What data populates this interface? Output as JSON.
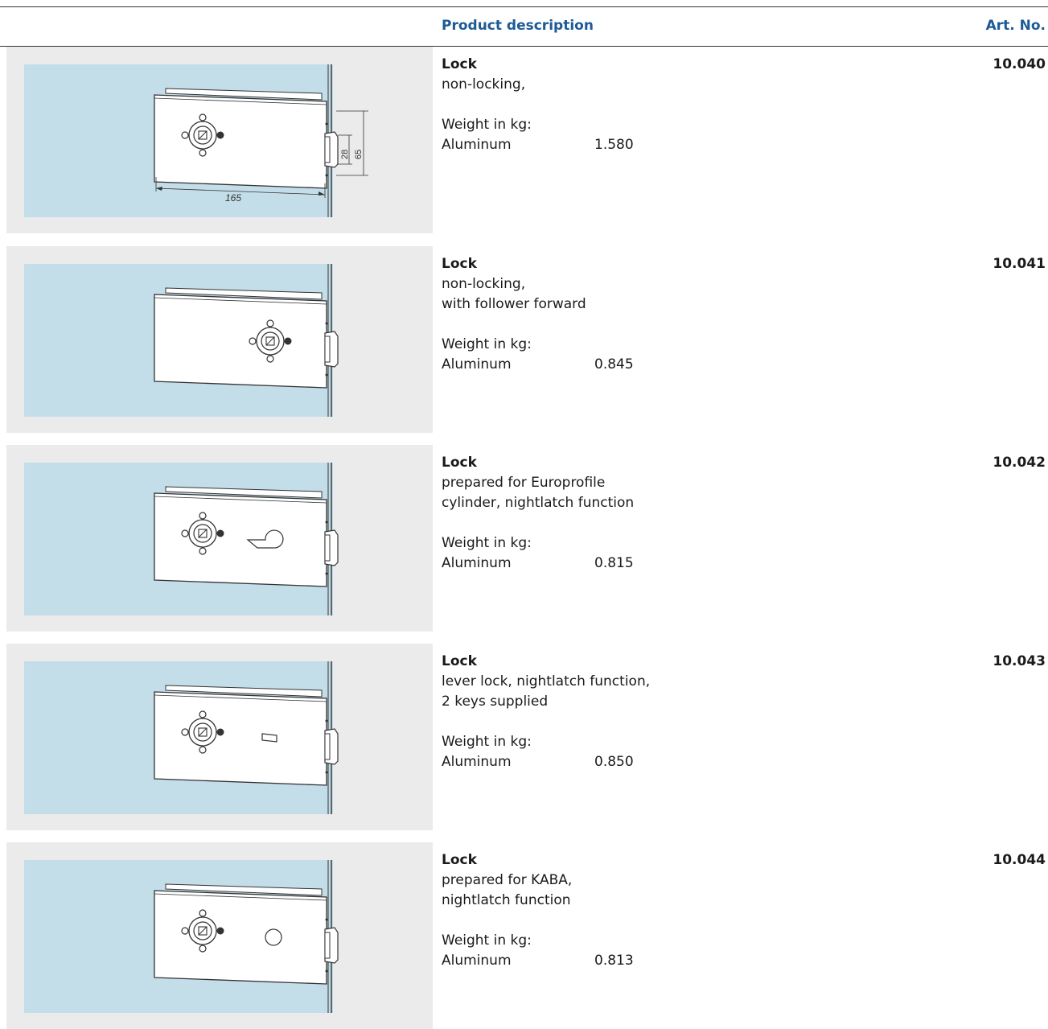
{
  "header": {
    "desc_label": "Product description",
    "art_label": "Art. No."
  },
  "colors": {
    "header_blue": "#1d5a96",
    "glass_blue": "#c3dde9",
    "panel_gray": "#ebebeb"
  },
  "products": [
    {
      "title": "Lock",
      "lines": [
        "non-locking,"
      ],
      "weight_label": "Weight in kg:",
      "material": "Aluminum",
      "weight": "1.580",
      "art_no": "10.040",
      "dims": {
        "width": "165",
        "h1": "28",
        "h2": "65"
      }
    },
    {
      "title": "Lock",
      "lines": [
        "non-locking,",
        "with follower forward"
      ],
      "weight_label": "Weight in kg:",
      "material": "Aluminum",
      "weight": "0.845",
      "art_no": "10.041"
    },
    {
      "title": "Lock",
      "lines": [
        "prepared for Europrofile",
        "cylinder, nightlatch function"
      ],
      "weight_label": "Weight in kg:",
      "material": "Aluminum",
      "weight": "0.815",
      "art_no": "10.042"
    },
    {
      "title": "Lock",
      "lines": [
        "lever lock, nightlatch function,",
        "2 keys supplied"
      ],
      "weight_label": "Weight in kg:",
      "material": "Aluminum",
      "weight": "0.850",
      "art_no": "10.043"
    },
    {
      "title": "Lock",
      "lines": [
        "prepared for KABA,",
        "nightlatch function"
      ],
      "weight_label": "Weight in kg:",
      "material": "Aluminum",
      "weight": "0.813",
      "art_no": "10.044"
    }
  ]
}
